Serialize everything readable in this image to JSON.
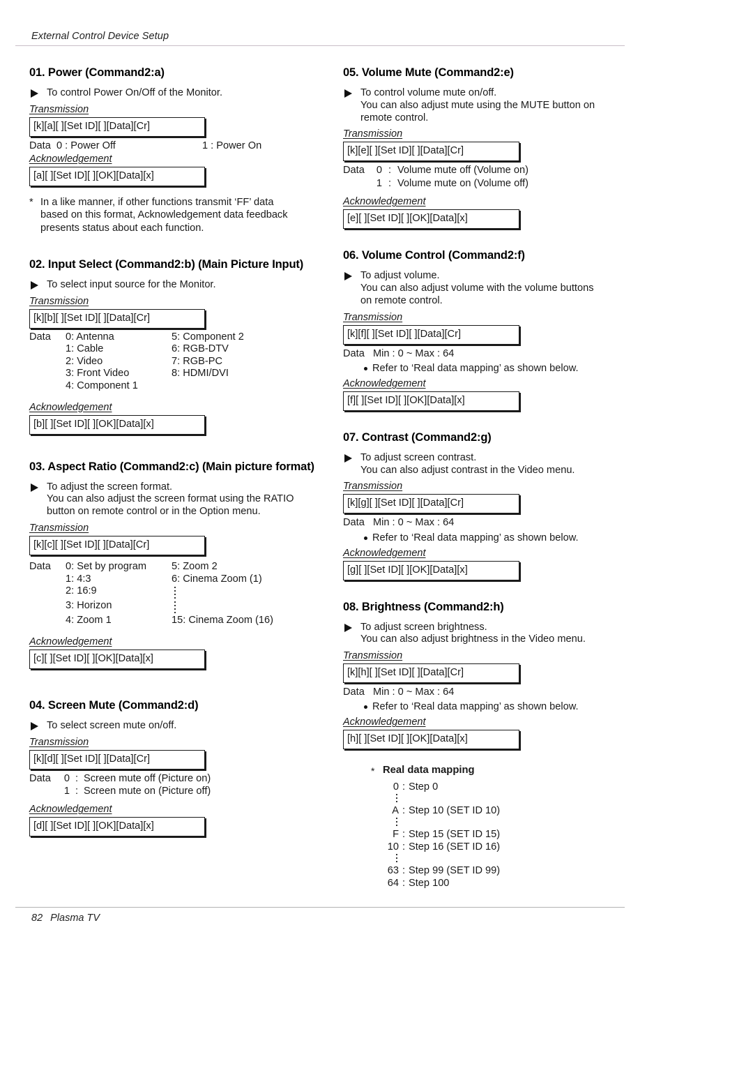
{
  "header": {
    "title": "External Control Device Setup"
  },
  "footer": {
    "page_number": "82",
    "product": "Plasma TV"
  },
  "labels": {
    "transmission": "Transmission",
    "acknowledgement": "Acknowledgement",
    "data": "Data",
    "refer_note": "Refer to ‘Real data mapping’ as shown below."
  },
  "sections": [
    {
      "id": "01",
      "title": "01. Power (Command2:a)",
      "desc": [
        "To control Power On/Off of the Monitor."
      ],
      "transmission": "[k][a][  ][Set ID][  ][Data][Cr]",
      "acknowledgement": "[a][  ][Set ID][  ][OK][Data][x]",
      "power_row": {
        "lead": "Data",
        "left_key": "0",
        "left_val": "Power Off",
        "right_key": "1",
        "right_val": "Power On"
      },
      "note": "In a like manner, if other functions transmit ‘FF’ data based on this format, Acknowledgement data feedback presents status about each function.",
      "note_lines": [
        "In a like manner, if other functions transmit ‘FF’ data",
        "based on this format, Acknowledgement data feedback",
        "presents status about each function."
      ]
    },
    {
      "id": "02",
      "title": "02. Input Select (Command2:b) (Main Picture Input)",
      "desc": [
        "To select input source for the Monitor."
      ],
      "transmission": "[k][b][  ][Set ID][  ][Data][Cr]",
      "acknowledgement": "[b][  ][Set ID][  ][OK][Data][x]",
      "data_lead": "Data",
      "data_col1": [
        "0: Antenna",
        "1: Cable",
        "2: Video",
        "3: Front Video",
        "4: Component 1"
      ],
      "data_col2": [
        "5: Component 2",
        "6: RGB-DTV",
        "7: RGB-PC",
        "8: HDMI/DVI",
        ""
      ]
    },
    {
      "id": "03",
      "title": "03. Aspect Ratio (Command2:c) (Main picture format)",
      "desc": [
        "To adjust the screen format.",
        "You can also adjust the screen format using the RATIO",
        "button on remote control or in the Option menu."
      ],
      "transmission": "[k][c][  ][Set ID][  ][Data][Cr]",
      "acknowledgement": "[c][  ][Set ID][  ][OK][Data][x]",
      "data_lead": "Data",
      "data_col1": [
        "0: Set by program",
        "1: 4:3",
        "2: 16:9",
        "3: Horizon",
        "4: Zoom 1"
      ],
      "data_col2_first": "5: Zoom 2",
      "data_col2_second": "6: Cinema Zoom (1)",
      "data_col2_last": "15: Cinema Zoom (16)"
    },
    {
      "id": "04",
      "title": "04. Screen Mute (Command2:d)",
      "desc": [
        "To select screen mute on/off."
      ],
      "transmission": "[k][d][  ][Set ID][  ][Data][Cr]",
      "acknowledgement": "[d][  ][Set ID][  ][OK][Data][x]",
      "rows": [
        {
          "lead": "Data",
          "key": "0",
          "sep": ":",
          "val": "Screen mute off (Picture on)"
        },
        {
          "lead": "",
          "key": "1",
          "sep": ":",
          "val": "Screen mute on (Picture off)"
        }
      ]
    },
    {
      "id": "05",
      "title": "05. Volume Mute (Command2:e)",
      "desc": [
        "To control volume mute on/off.",
        "You can also adjust mute using the MUTE button on",
        "remote control."
      ],
      "transmission": "[k][e][  ][Set ID][  ][Data][Cr]",
      "acknowledgement": "[e][  ][Set ID][  ][OK][Data][x]",
      "rows": [
        {
          "lead": "Data",
          "key": "0",
          "sep": ":",
          "val": "Volume mute off (Volume on)"
        },
        {
          "lead": "",
          "key": "1",
          "sep": ":",
          "val": "Volume mute on (Volume off)"
        }
      ]
    },
    {
      "id": "06",
      "title": "06. Volume Control (Command2:f)",
      "desc": [
        "To adjust volume.",
        "You can also adjust volume with the volume buttons",
        "on remote control."
      ],
      "transmission": "[k][f][  ][Set ID][  ][Data][Cr]",
      "acknowledgement": "[f][  ][Set ID][  ][OK][Data][x]",
      "range_line": "Data   Min : 0 ~ Max : 64"
    },
    {
      "id": "07",
      "title": "07. Contrast (Command2:g)",
      "desc": [
        "To adjust screen contrast.",
        "You can also adjust contrast in the Video menu."
      ],
      "transmission": "[k][g][  ][Set ID][  ][Data][Cr]",
      "acknowledgement": "[g][  ][Set ID][  ][OK][Data][x]",
      "range_line": "Data   Min : 0 ~ Max : 64"
    },
    {
      "id": "08",
      "title": "08. Brightness (Command2:h)",
      "desc": [
        "To adjust screen brightness.",
        "You can also adjust brightness in the Video menu."
      ],
      "transmission": "[k][h][  ][Set ID][  ][Data][Cr]",
      "acknowledgement": "[h][  ][Set ID][  ][OK][Data][x]",
      "range_line": "Data   Min : 0 ~ Max : 64"
    }
  ],
  "real_data_mapping": {
    "asterisk": "*",
    "title": "Real data mapping",
    "entries": [
      {
        "key": "0",
        "sep": ":",
        "val": "Step 0",
        "dots_after": true
      },
      {
        "key": "A",
        "sep": ":",
        "val": "Step 10 (SET ID 10)",
        "dots_after": true
      },
      {
        "key": "F",
        "sep": ":",
        "val": "Step 15 (SET ID 15)",
        "dots_after": false
      },
      {
        "key": "10",
        "sep": ":",
        "val": "Step 16 (SET ID 16)",
        "dots_after": true
      },
      {
        "key": "63",
        "sep": ":",
        "val": "Step 99 (SET ID 99)",
        "dots_after": false
      },
      {
        "key": "64",
        "sep": ":",
        "val": "Step 100",
        "dots_after": false
      }
    ]
  }
}
